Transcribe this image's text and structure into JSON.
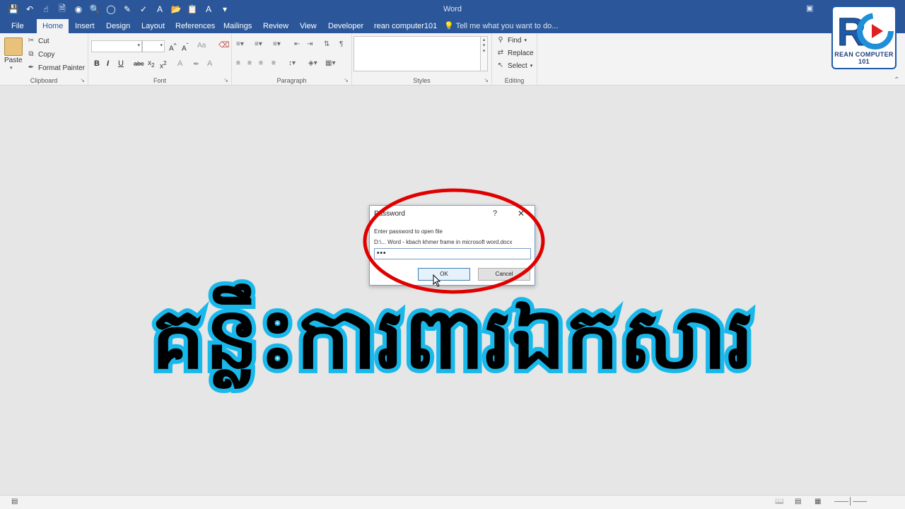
{
  "app": {
    "window_title": "Word"
  },
  "tabs": [
    {
      "label": "File"
    },
    {
      "label": "Home"
    },
    {
      "label": "Insert"
    },
    {
      "label": "Design"
    },
    {
      "label": "Layout"
    },
    {
      "label": "References"
    },
    {
      "label": "Mailings"
    },
    {
      "label": "Review"
    },
    {
      "label": "View"
    },
    {
      "label": "Developer"
    },
    {
      "label": "rean computer101"
    }
  ],
  "tell_me": "Tell me what you want to do...",
  "ribbon": {
    "clipboard": {
      "paste": "Paste",
      "cut": "Cut",
      "copy": "Copy",
      "format_painter": "Format Painter",
      "label": "Clipboard"
    },
    "font": {
      "label": "Font"
    },
    "paragraph": {
      "label": "Paragraph"
    },
    "styles": {
      "label": "Styles"
    },
    "editing": {
      "find": "Find",
      "replace": "Replace",
      "select": "Select",
      "label": "Editing"
    }
  },
  "logo": {
    "text": "REAN COMPUTER 101",
    "mark": "RC"
  },
  "dialog": {
    "title": "Password",
    "help": "?",
    "close": "✕",
    "prompt": "Enter password to open file",
    "path": "D:\\... Word - kbach khmer frame in microsoft word.docx",
    "password_mask": "•••",
    "ok": "OK",
    "cancel": "Cancel"
  },
  "headline_khmer": "គន្លឹះការពារឯកសារ",
  "colors": {
    "titlebar": "#2b579a",
    "ellipse": "#e00000",
    "khmer_outline": "#19b8ea",
    "khmer_fill": "#000000"
  }
}
